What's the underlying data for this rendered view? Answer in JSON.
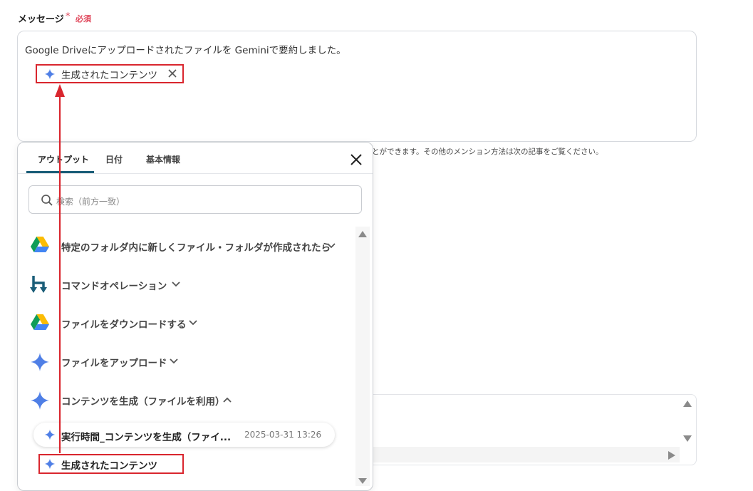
{
  "form": {
    "message_label": "メッセージ",
    "required_mark": "*",
    "required_text": "必須",
    "message_text": "Google Driveにアップロードされたファイルを Geminiで要約しました。",
    "mention_chip_label": "生成されたコンテンツ",
    "help_text_partial": "とができます。その他のメンション方法は次の記事をご覧ください。"
  },
  "popup": {
    "tabs": [
      {
        "label": "アウトプット",
        "active": true
      },
      {
        "label": "日付",
        "active": false
      },
      {
        "label": "基本情報",
        "active": false
      }
    ],
    "search_placeholder": "検索（前方一致）",
    "nodes": [
      {
        "icon": "google-drive-icon",
        "label": "特定のフォルダ内に新しくファイル・フォルダが作成されたら",
        "expanded": false
      },
      {
        "icon": "command-operation-icon",
        "label": "コマンドオペレーション",
        "expanded": false
      },
      {
        "icon": "google-drive-icon",
        "label": "ファイルをダウンロードする",
        "expanded": false
      },
      {
        "icon": "gemini-icon",
        "label": "ファイルをアップロード",
        "expanded": false
      },
      {
        "icon": "gemini-icon",
        "label": "コンテンツを生成（ファイルを利用）",
        "expanded": true
      }
    ],
    "output_chip": {
      "label": "実行時間_コンテンツを生成（ファイ...",
      "timestamp": "2025-03-31 13:26"
    },
    "selected_output": {
      "label": "生成されたコンテンツ"
    }
  },
  "colors": {
    "accent_tab": "#1a5d78",
    "highlight_red": "#d9262e",
    "required_red": "#e0475b"
  }
}
